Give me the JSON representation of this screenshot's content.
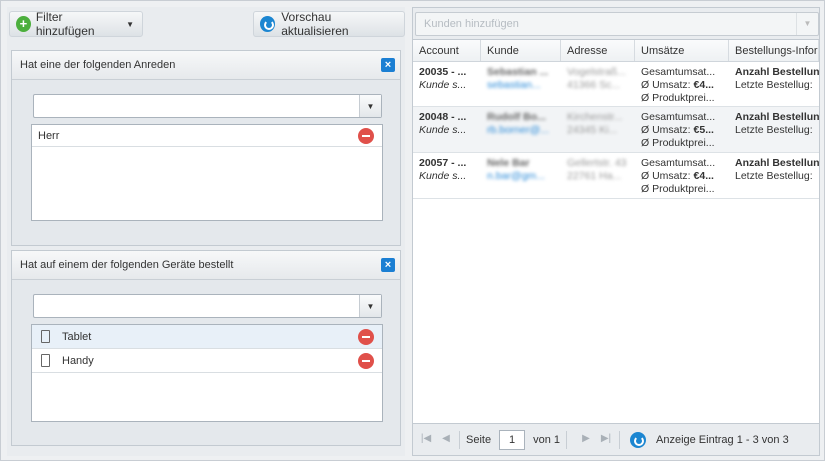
{
  "toolbar": {
    "add_filter_label": "Filter hinzufügen",
    "refresh_label": "Vorschau aktualisieren"
  },
  "filters": [
    {
      "title": "Hat eine der folgenden Anreden",
      "combo_value": "",
      "items": [
        {
          "label": "Herr"
        }
      ]
    },
    {
      "title": "Hat auf einem der folgenden Geräte bestellt",
      "combo_value": "",
      "items": [
        {
          "label": "Tablet",
          "icon": "tablet-icon"
        },
        {
          "label": "Handy",
          "icon": "phone-icon"
        }
      ]
    }
  ],
  "customers": {
    "placeholder": "Kunden hinzufügen",
    "columns": [
      "Account",
      "Kunde",
      "Adresse",
      "Umsätze",
      "Bestellungs-Infor"
    ],
    "rows": [
      {
        "account_id": "20035 - ...",
        "account_sub": "Kunde s...",
        "name": "Sebastian ...",
        "email": "sebastian...",
        "address1": "Vogelstraß...",
        "address2": "41366 Sc...",
        "sales1": "Gesamtumsat...",
        "sales2_prefix": "Ø Umsatz: ",
        "sales2_value": "€4...",
        "sales3": "Ø Produktprei...",
        "order1": "Anzahl Bestellun",
        "order2": "Letzte Bestellug:"
      },
      {
        "account_id": "20048 - ...",
        "account_sub": "Kunde s...",
        "name": "Rudolf Bo...",
        "email": "rb.borner@...",
        "address1": "Kirchenstr...",
        "address2": "24345 Ki...",
        "sales1": "Gesamtumsat...",
        "sales2_prefix": "Ø Umsatz: ",
        "sales2_value": "€5...",
        "sales3": "Ø Produktprei...",
        "order1": "Anzahl Bestellun",
        "order2": "Letzte Bestellug:"
      },
      {
        "account_id": "20057 - ...",
        "account_sub": "Kunde s...",
        "name": "Nele Bar",
        "email": "n.bar@gm...",
        "address1": "Gellertstr. 43",
        "address2": "22761 Ha...",
        "sales1": "Gesamtumsat...",
        "sales2_prefix": "Ø Umsatz: ",
        "sales2_value": "€4...",
        "sales3": "Ø Produktprei...",
        "order1": "Anzahl Bestellun",
        "order2": "Letzte Bestellug:"
      }
    ]
  },
  "pager": {
    "page_label": "Seite",
    "page_value": "1",
    "of_label": "von 1",
    "display_label": "Anzeige Eintrag 1 - 3 von 3"
  }
}
